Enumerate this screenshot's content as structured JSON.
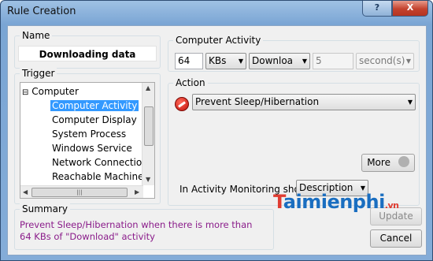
{
  "window": {
    "title": "Rule Creation",
    "help_label": "?",
    "close_label": "X"
  },
  "name": {
    "label": "Name",
    "value": "Downloading data"
  },
  "trigger": {
    "label": "Trigger",
    "tree": {
      "expander": "⊟",
      "root": "Computer",
      "items": [
        "Computer Activity",
        "Computer Display",
        "System Process",
        "Windows Service",
        "Network Connections",
        "Reachable Machines"
      ],
      "selected_index": 0
    },
    "hscroll_grip": "|||"
  },
  "computer_activity": {
    "label": "Computer Activity",
    "amount": "64",
    "unit": "KBs",
    "direction": "Downloa",
    "duration": "5",
    "duration_unit": "second(s)"
  },
  "action": {
    "label": "Action",
    "selected": "Prevent Sleep/Hibernation",
    "more_label": "More",
    "monitoring_label": "In Activity Monitoring show",
    "monitoring_value": "Description"
  },
  "summary": {
    "label": "Summary",
    "text": "Prevent Sleep/Hibernation when there is more than 64 KBs of \"Download\" activity"
  },
  "buttons": {
    "update": "Update",
    "cancel": "Cancel"
  },
  "watermark": {
    "brand": "Taimienphi",
    "suffix": ".vn"
  }
}
